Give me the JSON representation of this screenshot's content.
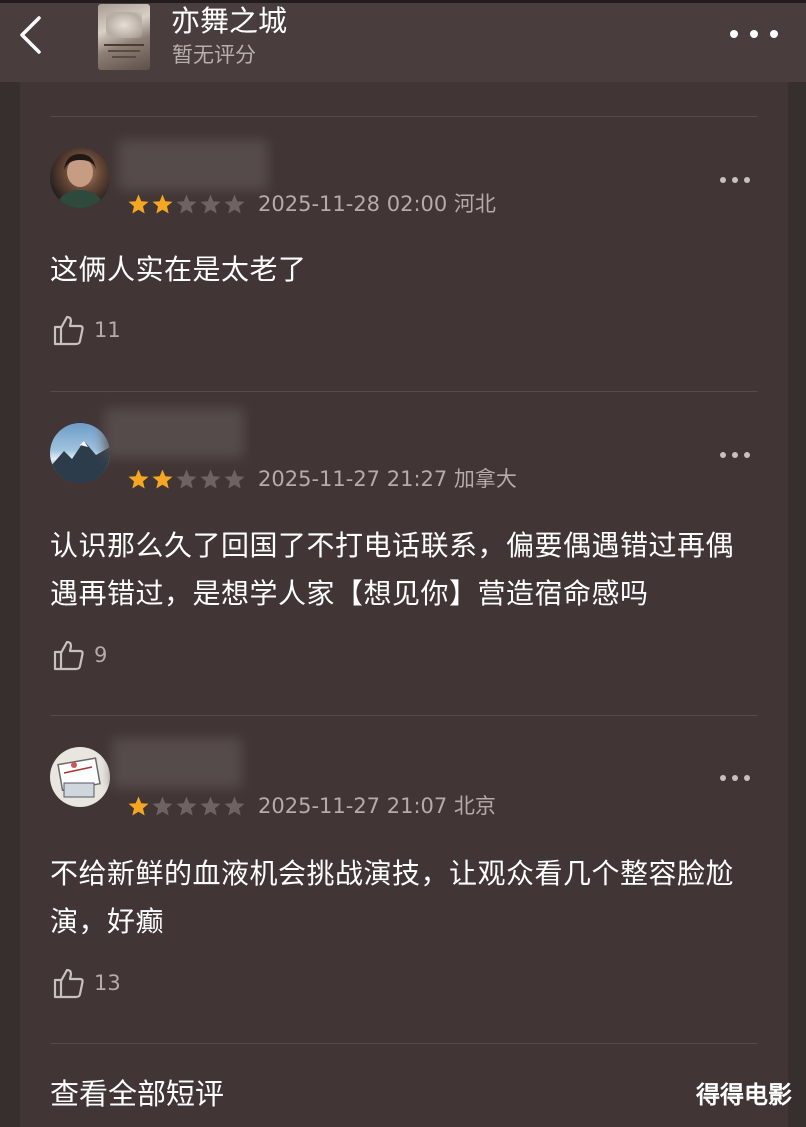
{
  "header": {
    "title": "亦舞之城",
    "subtitle": "暂无评分",
    "back_icon": "chevron-left-icon",
    "more_icon": "more-horizontal-icon"
  },
  "reviews": [
    {
      "stars": 2,
      "max_stars": 5,
      "meta": "2025-11-28 02:00 河北",
      "content": "这俩人实在是太老了",
      "likes": "11"
    },
    {
      "stars": 2,
      "max_stars": 5,
      "meta": "2025-11-27 21:27 加拿大",
      "content": "认识那么久了回国了不打电话联系，偏要偶遇错过再偶遇再错过，是想学人家【想见你】营造宿命感吗",
      "likes": "9"
    },
    {
      "stars": 1,
      "max_stars": 5,
      "meta": "2025-11-27 21:07 北京",
      "content": "不给新鲜的血液机会挑战演技，让观众看几个整容脸尬演，好癫",
      "likes": "13"
    }
  ],
  "footer": {
    "view_all": "查看全部短评",
    "watermark": "得得电影"
  },
  "colors": {
    "star_filled": "#f5a623",
    "star_empty": "#6e6262",
    "background": "#413535"
  }
}
